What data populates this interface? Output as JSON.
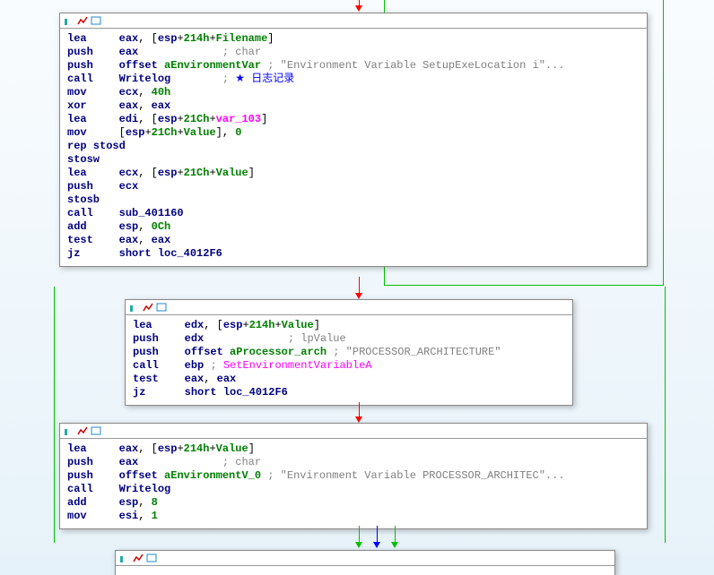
{
  "n1": {
    "l0": {
      "m": "lea",
      "r": "eax",
      "b": "esp",
      "o": "214h",
      "v": "Filename"
    },
    "l1": {
      "m": "push",
      "r": "eax",
      "c": "; char"
    },
    "l2": {
      "m": "push",
      "v": "aEnvironmentVar",
      "c": "; \"Environment Variable SetupExeLocation i\"..."
    },
    "l3": {
      "m": "call",
      "f": "Writelog",
      "c": "★ 日志记录"
    },
    "l4": {
      "m": "mov",
      "r": "ecx",
      "n": "40h"
    },
    "l5": {
      "m": "xor",
      "a": "eax",
      "b": "eax"
    },
    "l6": {
      "m": "lea",
      "r": "edi",
      "b": "esp",
      "o": "21Ch",
      "v": "var_103"
    },
    "l7": {
      "m": "mov",
      "b": "esp",
      "o": "21Ch",
      "v": "Value",
      "n": "0"
    },
    "l8": {
      "m": "rep stosd"
    },
    "l9": {
      "m": "stosw"
    },
    "l10": {
      "m": "lea",
      "r": "ecx",
      "b": "esp",
      "o": "21Ch",
      "v": "Value"
    },
    "l11": {
      "m": "push",
      "r": "ecx"
    },
    "l12": {
      "m": "stosb"
    },
    "l13": {
      "m": "call",
      "f": "sub_401160"
    },
    "l14": {
      "m": "add",
      "r": "esp",
      "n": "0Ch"
    },
    "l15": {
      "m": "test",
      "a": "eax",
      "b": "eax"
    },
    "l16": {
      "m": "jz",
      "f": "short loc_4012F6"
    }
  },
  "n2": {
    "l0": {
      "m": "lea",
      "r": "edx",
      "b": "esp",
      "o": "214h",
      "v": "Value"
    },
    "l1": {
      "m": "push",
      "r": "edx",
      "c": "; lpValue"
    },
    "l2": {
      "m": "push",
      "v": "aProcessor_arch",
      "c": "; \"PROCESSOR_ARCHITECTURE\""
    },
    "l3": {
      "m": "call",
      "r": "ebp",
      "f": "SetEnvironmentVariableA"
    },
    "l4": {
      "m": "test",
      "a": "eax",
      "b": "eax"
    },
    "l5": {
      "m": "jz",
      "f": "short loc_4012F6"
    }
  },
  "n3": {
    "l0": {
      "m": "lea",
      "r": "eax",
      "b": "esp",
      "o": "214h",
      "v": "Value"
    },
    "l1": {
      "m": "push",
      "r": "eax",
      "c": "; char"
    },
    "l2": {
      "m": "push",
      "v": "aEnvironmentV_0",
      "c": "; \"Environment Variable PROCESSOR_ARCHITEC\"..."
    },
    "l3": {
      "m": "call",
      "f": "Writelog"
    },
    "l4": {
      "m": "add",
      "r": "esp",
      "n": "8"
    },
    "l5": {
      "m": "mov",
      "r": "esi",
      "n": "1"
    }
  }
}
